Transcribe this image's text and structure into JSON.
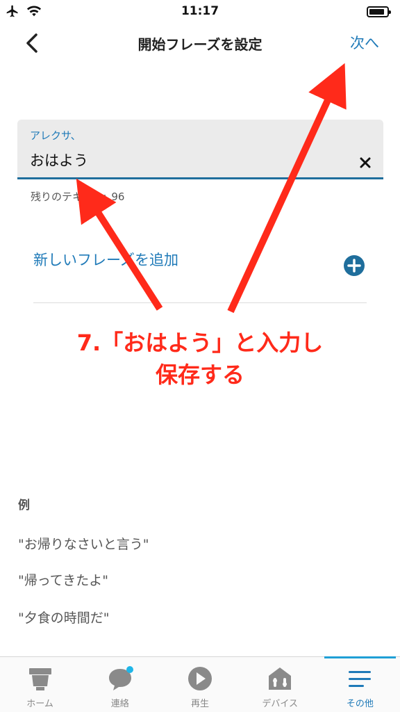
{
  "status_bar": {
    "time": "11:17"
  },
  "nav": {
    "title": "開始フレーズを設定",
    "next_label": "次へ"
  },
  "field": {
    "label": "アレクサ、",
    "value": "おはよう",
    "remaining_label": "残りのテキスト:",
    "remaining_count": "96"
  },
  "add_phrase": {
    "label": "新しいフレーズを追加"
  },
  "annotation": {
    "line1": "7.「おはよう」と入力し",
    "line2": "保存する",
    "color": "#ff2a1a"
  },
  "examples": {
    "heading": "例",
    "items": [
      "\"お帰りなさいと言う\"",
      "\"帰ってきたよ\"",
      "\"夕食の時間だ\""
    ]
  },
  "tabbar": {
    "tabs": [
      {
        "label": "ホーム",
        "icon": "home-icon"
      },
      {
        "label": "連絡",
        "icon": "chat-bubble-icon"
      },
      {
        "label": "再生",
        "icon": "play-icon"
      },
      {
        "label": "デバイス",
        "icon": "devices-icon"
      },
      {
        "label": "その他",
        "icon": "menu-icon",
        "active": true
      }
    ]
  },
  "colors": {
    "accent": "#1f7ab8",
    "annotation": "#ff2a1a"
  }
}
